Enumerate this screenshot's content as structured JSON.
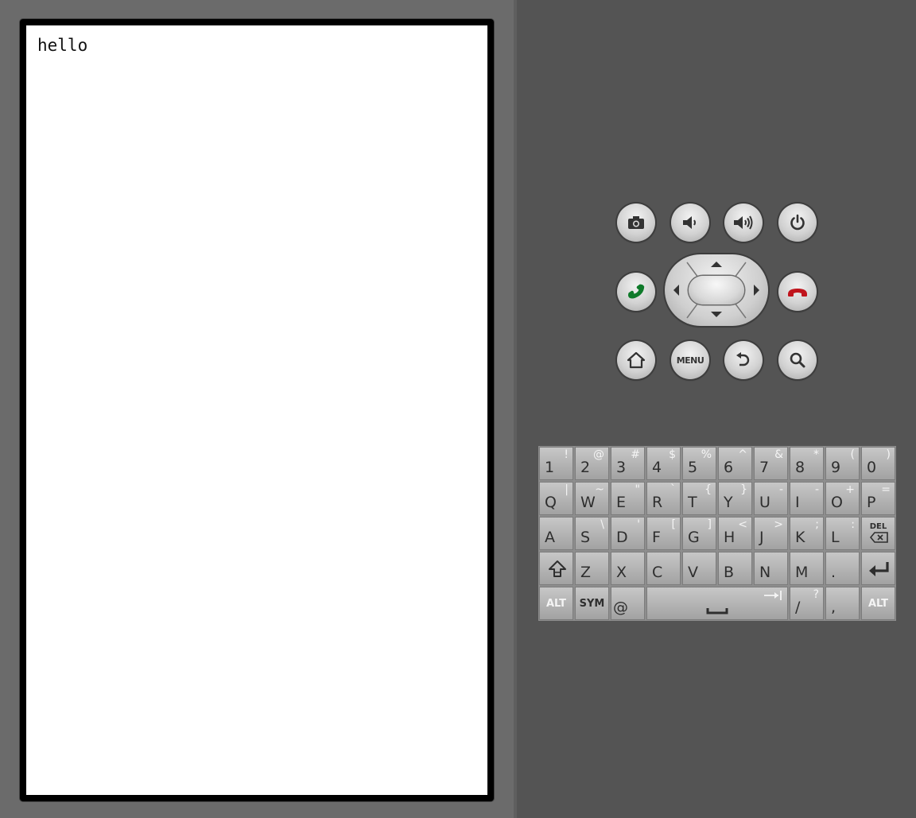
{
  "screen": {
    "text": "hello"
  },
  "controls": {
    "menu_label": "MENU"
  },
  "keyboard": {
    "row1": [
      {
        "main": "1",
        "alt": "!"
      },
      {
        "main": "2",
        "alt": "@"
      },
      {
        "main": "3",
        "alt": "#"
      },
      {
        "main": "4",
        "alt": "$"
      },
      {
        "main": "5",
        "alt": "%"
      },
      {
        "main": "6",
        "alt": "^"
      },
      {
        "main": "7",
        "alt": "&"
      },
      {
        "main": "8",
        "alt": "*"
      },
      {
        "main": "9",
        "alt": "("
      },
      {
        "main": "0",
        "alt": ")"
      }
    ],
    "row2": [
      {
        "main": "Q",
        "alt": "|"
      },
      {
        "main": "W",
        "alt": "~"
      },
      {
        "main": "E",
        "alt": "\""
      },
      {
        "main": "R",
        "alt": "`"
      },
      {
        "main": "T",
        "alt": "{"
      },
      {
        "main": "Y",
        "alt": "}"
      },
      {
        "main": "U",
        "alt": "-"
      },
      {
        "main": "I",
        "alt": "-"
      },
      {
        "main": "O",
        "alt": "+"
      },
      {
        "main": "P",
        "alt": "="
      }
    ],
    "row3": [
      {
        "main": "A",
        "alt": ""
      },
      {
        "main": "S",
        "alt": "\\"
      },
      {
        "main": "D",
        "alt": "'"
      },
      {
        "main": "F",
        "alt": "["
      },
      {
        "main": "G",
        "alt": "]"
      },
      {
        "main": "H",
        "alt": "<"
      },
      {
        "main": "J",
        "alt": ">"
      },
      {
        "main": "K",
        "alt": ";"
      },
      {
        "main": "L",
        "alt": ":"
      }
    ],
    "del_label": "DEL",
    "row4": [
      {
        "main": "Z",
        "alt": ""
      },
      {
        "main": "X",
        "alt": ""
      },
      {
        "main": "C",
        "alt": ""
      },
      {
        "main": "V",
        "alt": ""
      },
      {
        "main": "B",
        "alt": ""
      },
      {
        "main": "N",
        "alt": ""
      },
      {
        "main": "M",
        "alt": ""
      },
      {
        "main": ".",
        "alt": ""
      }
    ],
    "alt_label": "ALT",
    "sym_label": "SYM",
    "at_label": "@",
    "slash": {
      "main": "/",
      "alt": "?"
    },
    "comma": {
      "main": ",",
      "alt": ""
    }
  }
}
